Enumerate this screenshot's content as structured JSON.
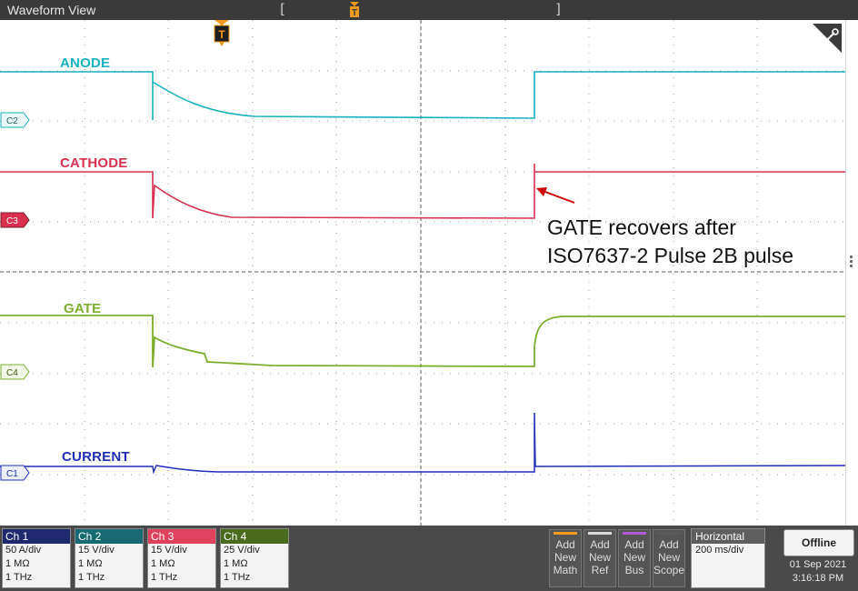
{
  "window": {
    "title": "Waveform View"
  },
  "trigger": {
    "marker": "T"
  },
  "record_brackets": {
    "left": "[",
    "right": "]"
  },
  "traces": [
    {
      "id": "C2",
      "label": "ANODE",
      "color": "#17b1bf"
    },
    {
      "id": "C3",
      "label": "CATHODE",
      "color": "#d9304f"
    },
    {
      "id": "C4",
      "label": "GATE",
      "color": "#7cad2e"
    },
    {
      "id": "C1",
      "label": "CURRENT",
      "color": "#1f2fb8"
    }
  ],
  "annotation": {
    "line1": "GATE recovers after",
    "line2": "ISO7637-2 Pulse 2B pulse",
    "arrow_color": "#cc0000"
  },
  "channels": [
    {
      "name": "Ch 1",
      "scale": "50 A/div",
      "impedance": "1 MΩ",
      "bandwidth": "1 THz",
      "color": "#1f2a6e"
    },
    {
      "name": "Ch 2",
      "scale": "15 V/div",
      "impedance": "1 MΩ",
      "bandwidth": "1 THz",
      "color": "#176a72"
    },
    {
      "name": "Ch 3",
      "scale": "15 V/div",
      "impedance": "1 MΩ",
      "bandwidth": "1 THz",
      "color": "#e0415d"
    },
    {
      "name": "Ch 4",
      "scale": "25 V/div",
      "impedance": "1 MΩ",
      "bandwidth": "1 THz",
      "color": "#4a6a1e"
    }
  ],
  "add_buttons": [
    {
      "line1": "Add",
      "line2": "New",
      "line3": "Math",
      "color": "#f29a1e"
    },
    {
      "line1": "Add",
      "line2": "New",
      "line3": "Ref",
      "color": "#d8d8d8"
    },
    {
      "line1": "Add",
      "line2": "New",
      "line3": "Bus",
      "color": "#b05ad6"
    },
    {
      "line1": "Add",
      "line2": "New",
      "line3": "Scope",
      "color": "#5a5a5a"
    }
  ],
  "horizontal": {
    "title": "Horizontal",
    "scale": "200 ms/div"
  },
  "status": {
    "mode": "Offline",
    "date": "01 Sep 2021",
    "time": "3:16:18 PM"
  },
  "icons": {
    "settings": "wrench-corner-icon",
    "trigger": "trigger-t-icon"
  }
}
